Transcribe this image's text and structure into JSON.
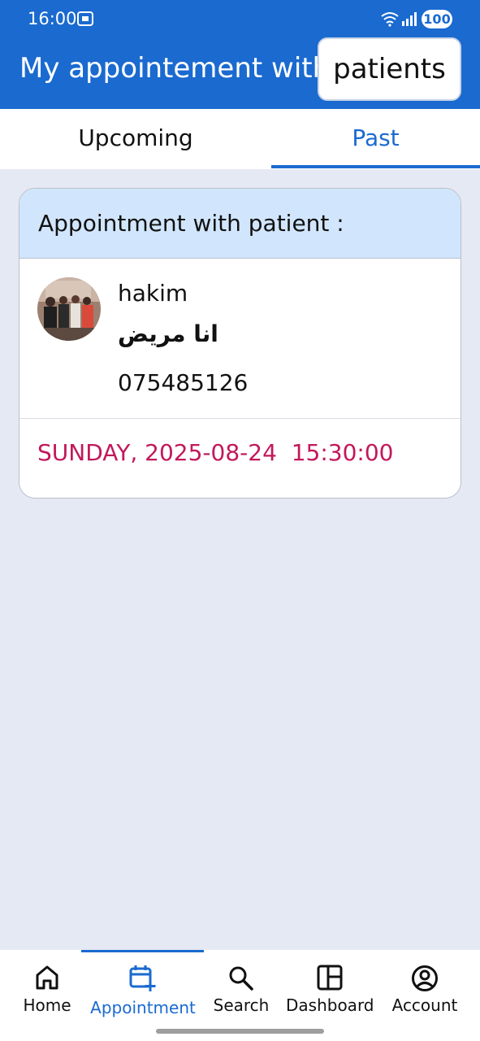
{
  "status_bar": {
    "time": "16:00",
    "battery": "100",
    "icons": [
      "screenshot-icon",
      "wifi-icon",
      "signal-icon",
      "battery-icon"
    ]
  },
  "header": {
    "title": "My appointement with",
    "chip_label": "patients",
    "background_color": "#1a6ad0"
  },
  "tabs": [
    {
      "label": "Upcoming",
      "active": false
    },
    {
      "label": "Past",
      "active": true
    }
  ],
  "appointment": {
    "header": "Appointment with patient :",
    "patient_name": "hakim",
    "note": "انا مريض",
    "phone": "075485126",
    "date": "SUNDAY, 2025-08-24",
    "time": "15:30:00",
    "date_color": "#c2185b"
  },
  "bottom_nav": {
    "items": [
      {
        "label": "Home",
        "icon": "home-icon",
        "active": false
      },
      {
        "label": "Appointment",
        "icon": "calendar-add-icon",
        "active": true
      },
      {
        "label": "Search",
        "icon": "search-icon",
        "active": false
      },
      {
        "label": "Dashboard",
        "icon": "dashboard-icon",
        "active": false
      },
      {
        "label": "Account",
        "icon": "account-icon",
        "active": false
      }
    ]
  }
}
